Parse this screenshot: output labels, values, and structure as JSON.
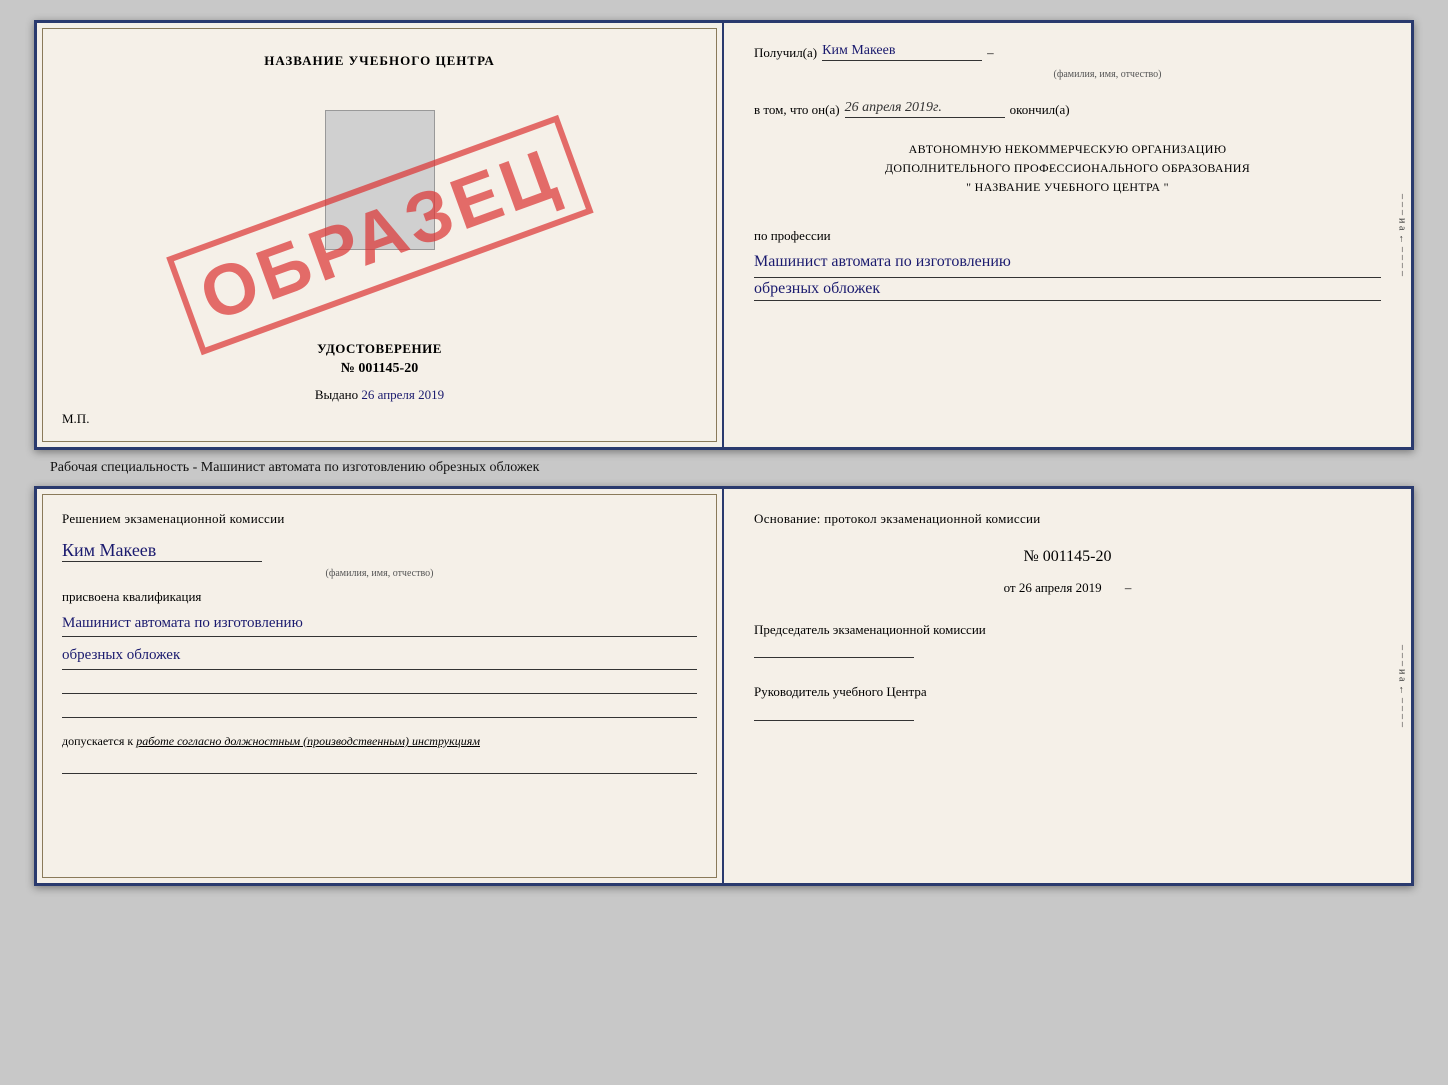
{
  "top_cert": {
    "left": {
      "title": "НАЗВАНИЕ УЧЕБНОГО ЦЕНТРА",
      "doc_type": "УДОСТОВЕРЕНИЕ",
      "number": "№ 001145-20",
      "issued_label": "Выдано",
      "issued_date": "26 апреля 2019",
      "mp_label": "М.П.",
      "stamp": "ОБРАЗЕЦ"
    },
    "right": {
      "received_label": "Получил(а)",
      "recipient_name": "Ким Макеев",
      "name_sub": "(фамилия, имя, отчество)",
      "in_that_label": "в том, что он(а)",
      "completion_date": "26 апреля 2019г.",
      "finished_label": "окончил(а)",
      "org_line1": "АВТОНОМНУЮ НЕКОММЕРЧЕСКУЮ ОРГАНИЗАЦИЮ",
      "org_line2": "ДОПОЛНИТЕЛЬНОГО ПРОФЕССИОНАЛЬНОГО ОБРАЗОВАНИЯ",
      "org_line3": "\"   НАЗВАНИЕ УЧЕБНОГО ЦЕНТРА   \"",
      "profession_label": "по профессии",
      "profession_line1": "Машинист автомата по изготовлению",
      "profession_line2": "обрезных обложек"
    }
  },
  "caption": {
    "text": "Рабочая специальность - Машинист автомата по изготовлению обрезных обложек"
  },
  "bottom_cert": {
    "left": {
      "decision_text": "Решением экзаменационной комиссии",
      "name": "Ким Макеев",
      "name_sub": "(фамилия, имя, отчество)",
      "assigned_label": "присвоена квалификация",
      "qualification_line1": "Машинист автомата по изготовлению",
      "qualification_line2": "обрезных обложек",
      "допускается_label": "допускается к",
      "допускается_value": "работе согласно должностным (производственным) инструкциям"
    },
    "right": {
      "osnov_label": "Основание: протокол экзаменационной комиссии",
      "protocol_number": "№  001145-20",
      "date_prefix": "от",
      "date": "26 апреля 2019",
      "chairman_label": "Председатель экзаменационной комиссии",
      "rukovoditel_label": "Руководитель учебного Центра"
    }
  },
  "side_marks": [
    "-",
    "-",
    "-",
    "и",
    "а",
    "←",
    "-",
    "-",
    "-",
    "-"
  ],
  "side_marks_bottom": [
    "-",
    "-",
    "-",
    "и",
    "а",
    "←",
    "-",
    "-",
    "-",
    "-"
  ]
}
